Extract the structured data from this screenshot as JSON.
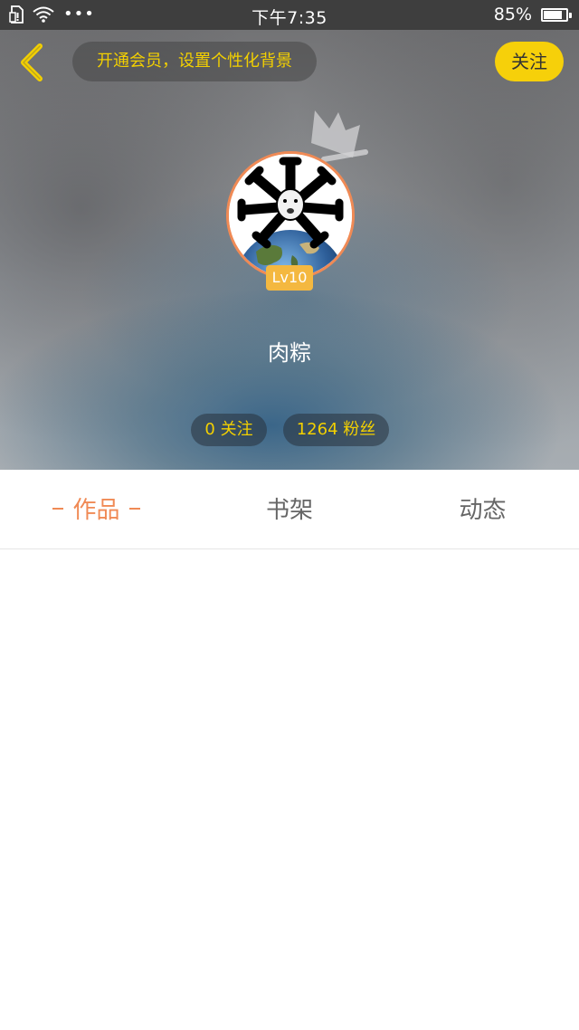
{
  "status_bar": {
    "time": "下午7:35",
    "battery_percent": "85%",
    "battery_level": 0.85,
    "icons": [
      "sim-icon",
      "wifi-icon",
      "more-dots-icon",
      "battery-icon"
    ]
  },
  "header": {
    "vip_banner": "开通会员，设置个性化背景",
    "follow_label": "关注",
    "level": "Lv10",
    "username": "肉粽",
    "following": "0 关注",
    "fans": "1264 粉丝"
  },
  "tabs": [
    {
      "label": "作品",
      "active": true
    },
    {
      "label": "书架",
      "active": false
    },
    {
      "label": "动态",
      "active": false
    }
  ],
  "colors": {
    "accent": "#f08a55",
    "highlight_yellow": "#f3d000",
    "follow_button": "#f6d00a",
    "level_badge": "#f4b840"
  }
}
